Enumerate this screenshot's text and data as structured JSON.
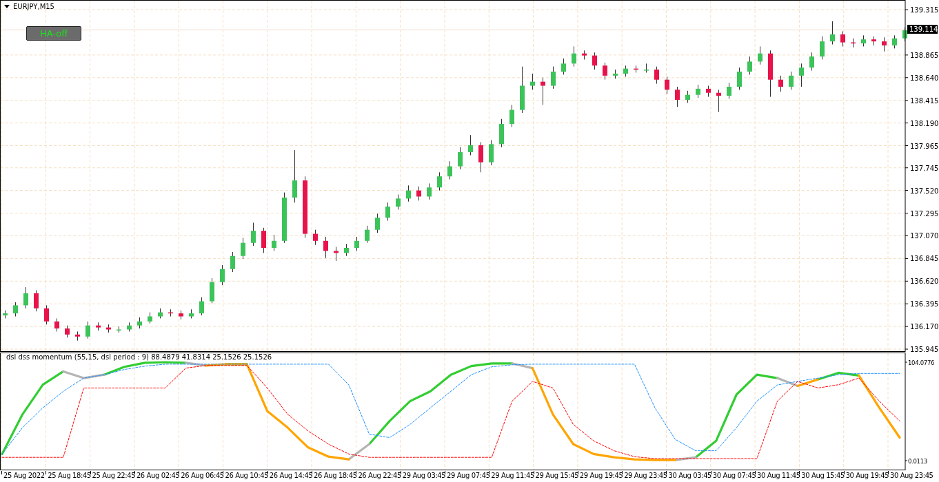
{
  "price_chart": {
    "symbol": "EURJPY,M15",
    "ha_button": "HA-off",
    "chart_data": {
      "type": "candlestick",
      "grid": true,
      "ylim": [
        135.918,
        139.411
      ],
      "yticks": [
        {
          "value": 139.315,
          "label": "139.315"
        },
        {
          "value": 138.865,
          "label": "138.865"
        },
        {
          "value": 138.64,
          "label": "138.640"
        },
        {
          "value": 138.415,
          "label": "138.415"
        },
        {
          "value": 138.19,
          "label": "138.190"
        },
        {
          "value": 137.965,
          "label": "137.965"
        },
        {
          "value": 137.745,
          "label": "137.745"
        },
        {
          "value": 137.52,
          "label": "137.520"
        },
        {
          "value": 137.295,
          "label": "137.295"
        },
        {
          "value": 137.07,
          "label": "137.070"
        },
        {
          "value": 136.845,
          "label": "136.845"
        },
        {
          "value": 136.62,
          "label": "136.620"
        },
        {
          "value": 136.395,
          "label": "136.395"
        },
        {
          "value": 136.17,
          "label": "136.170"
        },
        {
          "value": 135.945,
          "label": "135.945"
        }
      ],
      "ref_lines": [
        {
          "axis": "y",
          "value": 139.114,
          "label": "139.114"
        }
      ],
      "ohlc": [
        [
          136.28,
          136.33,
          136.25,
          136.3
        ],
        [
          136.3,
          136.41,
          136.27,
          136.38
        ],
        [
          136.38,
          136.56,
          136.35,
          136.5
        ],
        [
          136.5,
          136.53,
          136.32,
          136.35
        ],
        [
          136.35,
          136.38,
          136.19,
          136.22
        ],
        [
          136.22,
          136.25,
          136.12,
          136.15
        ],
        [
          136.15,
          136.18,
          136.06,
          136.09
        ],
        [
          136.09,
          136.12,
          136.03,
          136.07
        ],
        [
          136.07,
          136.22,
          136.05,
          136.18
        ],
        [
          136.18,
          136.21,
          136.13,
          136.16
        ],
        [
          136.16,
          136.19,
          136.11,
          136.14
        ],
        [
          136.14,
          136.17,
          136.11,
          136.14
        ],
        [
          136.14,
          136.21,
          136.12,
          136.18
        ],
        [
          136.18,
          136.26,
          136.15,
          136.22
        ],
        [
          136.22,
          136.31,
          136.2,
          136.27
        ],
        [
          136.27,
          136.35,
          136.25,
          136.31
        ],
        [
          136.31,
          136.34,
          136.27,
          136.3
        ],
        [
          136.3,
          136.33,
          136.24,
          136.27
        ],
        [
          136.27,
          136.34,
          136.25,
          136.3
        ],
        [
          136.3,
          136.46,
          136.28,
          136.42
        ],
        [
          136.42,
          136.65,
          136.4,
          136.61
        ],
        [
          136.61,
          136.78,
          136.58,
          136.74
        ],
        [
          136.74,
          136.91,
          136.71,
          136.87
        ],
        [
          136.87,
          137.05,
          136.84,
          137.0
        ],
        [
          137.0,
          137.2,
          136.97,
          137.12
        ],
        [
          137.12,
          137.15,
          136.9,
          136.95
        ],
        [
          136.95,
          137.08,
          136.92,
          137.02
        ],
        [
          137.02,
          137.5,
          137.0,
          137.45
        ],
        [
          137.45,
          137.92,
          137.4,
          137.62
        ],
        [
          137.62,
          137.66,
          137.05,
          137.09
        ],
        [
          137.09,
          137.13,
          136.98,
          137.02
        ],
        [
          137.02,
          137.06,
          136.85,
          136.92
        ],
        [
          136.92,
          136.96,
          136.82,
          136.9
        ],
        [
          136.9,
          136.99,
          136.87,
          136.95
        ],
        [
          136.95,
          137.06,
          136.92,
          137.02
        ],
        [
          137.02,
          137.17,
          137.0,
          137.13
        ],
        [
          137.13,
          137.29,
          137.1,
          137.25
        ],
        [
          137.25,
          137.4,
          137.22,
          137.36
        ],
        [
          137.36,
          137.48,
          137.33,
          137.44
        ],
        [
          137.44,
          137.57,
          137.41,
          137.52
        ],
        [
          137.52,
          137.56,
          137.42,
          137.46
        ],
        [
          137.46,
          137.59,
          137.43,
          137.55
        ],
        [
          137.55,
          137.7,
          137.52,
          137.66
        ],
        [
          137.66,
          137.81,
          137.63,
          137.76
        ],
        [
          137.76,
          137.95,
          137.73,
          137.9
        ],
        [
          137.9,
          138.07,
          137.87,
          137.97
        ],
        [
          137.97,
          138.0,
          137.7,
          137.8
        ],
        [
          137.8,
          138.02,
          137.77,
          137.98
        ],
        [
          137.98,
          138.23,
          137.95,
          138.18
        ],
        [
          138.18,
          138.37,
          138.15,
          138.32
        ],
        [
          138.32,
          138.75,
          138.29,
          138.56
        ],
        [
          138.56,
          138.68,
          138.52,
          138.6
        ],
        [
          138.6,
          138.64,
          138.37,
          138.56
        ],
        [
          138.56,
          138.75,
          138.53,
          138.7
        ],
        [
          138.7,
          138.83,
          138.67,
          138.78
        ],
        [
          138.78,
          138.95,
          138.75,
          138.88
        ],
        [
          138.88,
          138.91,
          138.82,
          138.86
        ],
        [
          138.86,
          138.89,
          138.72,
          138.76
        ],
        [
          138.76,
          138.79,
          138.62,
          138.66
        ],
        [
          138.66,
          138.72,
          138.63,
          138.68
        ],
        [
          138.68,
          138.76,
          138.65,
          138.73
        ],
        [
          138.73,
          138.76,
          138.69,
          138.72
        ],
        [
          138.72,
          138.78,
          138.69,
          138.72
        ],
        [
          138.72,
          138.75,
          138.58,
          138.62
        ],
        [
          138.62,
          138.65,
          138.48,
          138.52
        ],
        [
          138.52,
          138.55,
          138.35,
          138.42
        ],
        [
          138.42,
          138.51,
          138.39,
          138.47
        ],
        [
          138.47,
          138.57,
          138.44,
          138.53
        ],
        [
          138.53,
          138.56,
          138.45,
          138.49
        ],
        [
          138.49,
          138.52,
          138.3,
          138.46
        ],
        [
          138.46,
          138.59,
          138.43,
          138.55
        ],
        [
          138.55,
          138.74,
          138.52,
          138.7
        ],
        [
          138.7,
          138.85,
          138.67,
          138.8
        ],
        [
          138.8,
          138.95,
          138.77,
          138.88
        ],
        [
          138.88,
          138.91,
          138.45,
          138.62
        ],
        [
          138.62,
          138.66,
          138.5,
          138.55
        ],
        [
          138.55,
          138.7,
          138.52,
          138.66
        ],
        [
          138.66,
          138.78,
          138.55,
          138.74
        ],
        [
          138.74,
          138.89,
          138.71,
          138.85
        ],
        [
          138.85,
          139.05,
          138.82,
          139.0
        ],
        [
          139.0,
          139.2,
          138.97,
          139.07
        ],
        [
          139.07,
          139.1,
          138.95,
          138.99
        ],
        [
          138.99,
          139.03,
          138.94,
          138.98
        ],
        [
          138.98,
          139.06,
          138.95,
          139.02
        ],
        [
          139.02,
          139.05,
          138.96,
          139.0
        ],
        [
          139.0,
          139.04,
          138.9,
          138.96
        ],
        [
          138.96,
          139.06,
          138.93,
          139.03
        ],
        [
          139.03,
          139.14,
          139.0,
          139.11
        ]
      ]
    }
  },
  "indicator": {
    "chart_data": {
      "type": "line",
      "grid": true,
      "title": "dsl dss momentum (55,15, dsl period : 9) 88.4879 41.8314 25.1526 25.1526",
      "ylim": [
        -9.45,
        114.27
      ],
      "yticks": [
        {
          "value": 104.0776,
          "label": "104.0776"
        },
        {
          "value": 0.0113,
          "label": "0.0113"
        }
      ],
      "series": [
        {
          "color": "#32cd32",
          "line_style": "solid",
          "values": [
            7.0,
            48.9,
            80.3,
            94.3,
            null,
            90.8,
            99.2,
            103.4,
            104.1,
            103.4,
            null,
            102.0,
            102.0,
            null,
            null,
            null,
            null,
            null,
            17.5,
            41.9,
            62.9,
            73.3,
            90.8,
            100.0,
            102.7,
            102.7,
            null,
            null,
            null,
            null,
            null,
            null,
            null,
            null,
            3.5,
            20.9,
            69.9,
            90.8,
            87.3,
            null,
            85.9,
            92.9,
            90.0,
            null,
            null
          ]
        },
        {
          "color": "#b4b4b4",
          "line_style": "solid",
          "values": [
            null,
            null,
            null,
            94.3,
            87.3,
            90.8,
            null,
            null,
            null,
            103.4,
            100.6,
            null,
            null,
            null,
            null,
            null,
            null,
            1.4,
            17.5,
            null,
            null,
            null,
            null,
            null,
            null,
            102.7,
            97.8,
            null,
            null,
            null,
            null,
            null,
            null,
            0.7,
            3.5,
            null,
            null,
            null,
            87.3,
            78.9,
            null,
            null,
            null,
            null,
            null
          ]
        },
        {
          "color": "#ffa500",
          "line_style": "solid",
          "values": [
            null,
            null,
            null,
            null,
            null,
            null,
            null,
            null,
            null,
            null,
            100.6,
            102.0,
            102.0,
            52.4,
            34.9,
            14.0,
            4.2,
            1.4,
            null,
            null,
            null,
            null,
            null,
            null,
            null,
            null,
            97.8,
            48.9,
            17.5,
            7.0,
            3.5,
            1.4,
            0.7,
            0.7,
            null,
            null,
            null,
            null,
            null,
            78.9,
            85.9,
            null,
            90.0,
            55.9,
            24.4
          ]
        },
        {
          "color": "#1e90ff",
          "line_style": "dashed",
          "values": [
            7.0,
            34.9,
            55.9,
            73.3,
            87.3,
            90.8,
            96.4,
            99.9,
            102.0,
            102.0,
            102.0,
            102.0,
            102.0,
            102.0,
            102.0,
            102.0,
            102.0,
            80.0,
            28.0,
            24.4,
            38.4,
            55.9,
            73.3,
            90.8,
            99.2,
            101.3,
            102.0,
            102.0,
            102.0,
            102.0,
            102.0,
            102.0,
            55.9,
            22.4,
            10.5,
            10.5,
            34.9,
            62.9,
            80.0,
            83.8,
            87.3,
            90.8,
            92.2,
            92.2,
            92.2
          ]
        },
        {
          "color": "#ff0000",
          "line_style": "dashed",
          "values": [
            3.5,
            3.5,
            3.5,
            3.5,
            76.8,
            76.8,
            76.8,
            76.8,
            76.8,
            97.8,
            100.6,
            100.6,
            100.6,
            76.8,
            48.9,
            31.4,
            17.5,
            7.0,
            3.5,
            3.5,
            3.5,
            3.5,
            3.5,
            3.5,
            3.5,
            62.9,
            83.8,
            76.8,
            38.4,
            21.0,
            10.5,
            4.2,
            2.1,
            2.1,
            2.1,
            2.1,
            2.1,
            2.1,
            62.9,
            83.8,
            76.8,
            80.3,
            87.3,
            62.9,
            41.9
          ]
        }
      ]
    }
  },
  "time_axis": [
    "25 Aug 2022",
    "25 Aug 18:45",
    "25 Aug 22:45",
    "26 Aug 02:45",
    "26 Aug 06:45",
    "26 Aug 10:45",
    "26 Aug 14:45",
    "26 Aug 18:45",
    "26 Aug 22:45",
    "29 Aug 03:45",
    "29 Aug 07:45",
    "29 Aug 11:45",
    "29 Aug 15:45",
    "29 Aug 19:45",
    "29 Aug 23:45",
    "30 Aug 03:45",
    "30 Aug 07:45",
    "30 Aug 11:45",
    "30 Aug 15:45",
    "30 Aug 19:45",
    "30 Aug 23:45"
  ]
}
